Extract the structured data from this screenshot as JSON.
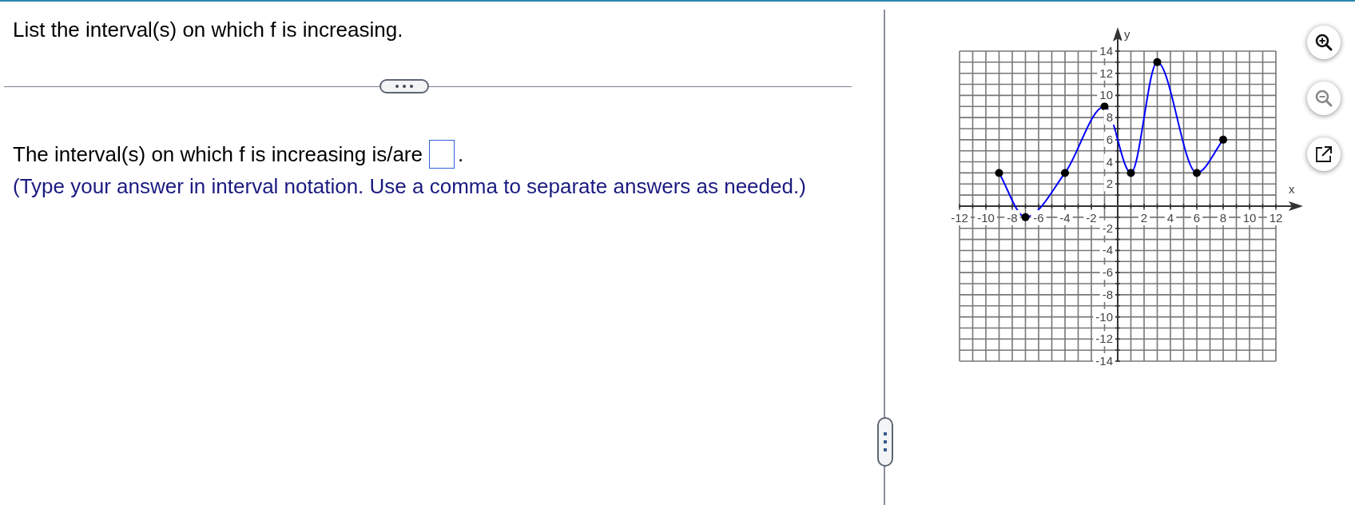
{
  "question": "List the interval(s) on which f is increasing.",
  "answer": {
    "prompt": "The interval(s) on which f is increasing is/are",
    "suffix": "."
  },
  "instruction": "(Type your answer in interval notation. Use a comma to separate answers as needed.)",
  "graph": {
    "chart_data": {
      "type": "line",
      "xlabel": "x",
      "ylabel": "y",
      "x": [
        -9,
        -7,
        -4,
        -1,
        1,
        3,
        6,
        8
      ],
      "grid": true,
      "series": [
        {
          "color": "#0000ff",
          "marker": "o",
          "values": [
            3,
            -1,
            3,
            9,
            3,
            13,
            3,
            6
          ]
        }
      ],
      "xlim": [
        -12,
        12
      ],
      "ylim": [
        -14,
        14
      ],
      "xticks": [
        -12,
        -10,
        -8,
        -6,
        -4,
        -2,
        2,
        4,
        6,
        8,
        10,
        12
      ],
      "yticks": [
        14,
        12,
        10,
        8,
        6,
        4,
        2,
        -2,
        -4,
        -6,
        -8,
        -10,
        -12,
        -14
      ]
    }
  },
  "tools": [
    {
      "kind": "zoom-in"
    },
    {
      "kind": "zoom-out"
    },
    {
      "kind": "popout"
    }
  ]
}
